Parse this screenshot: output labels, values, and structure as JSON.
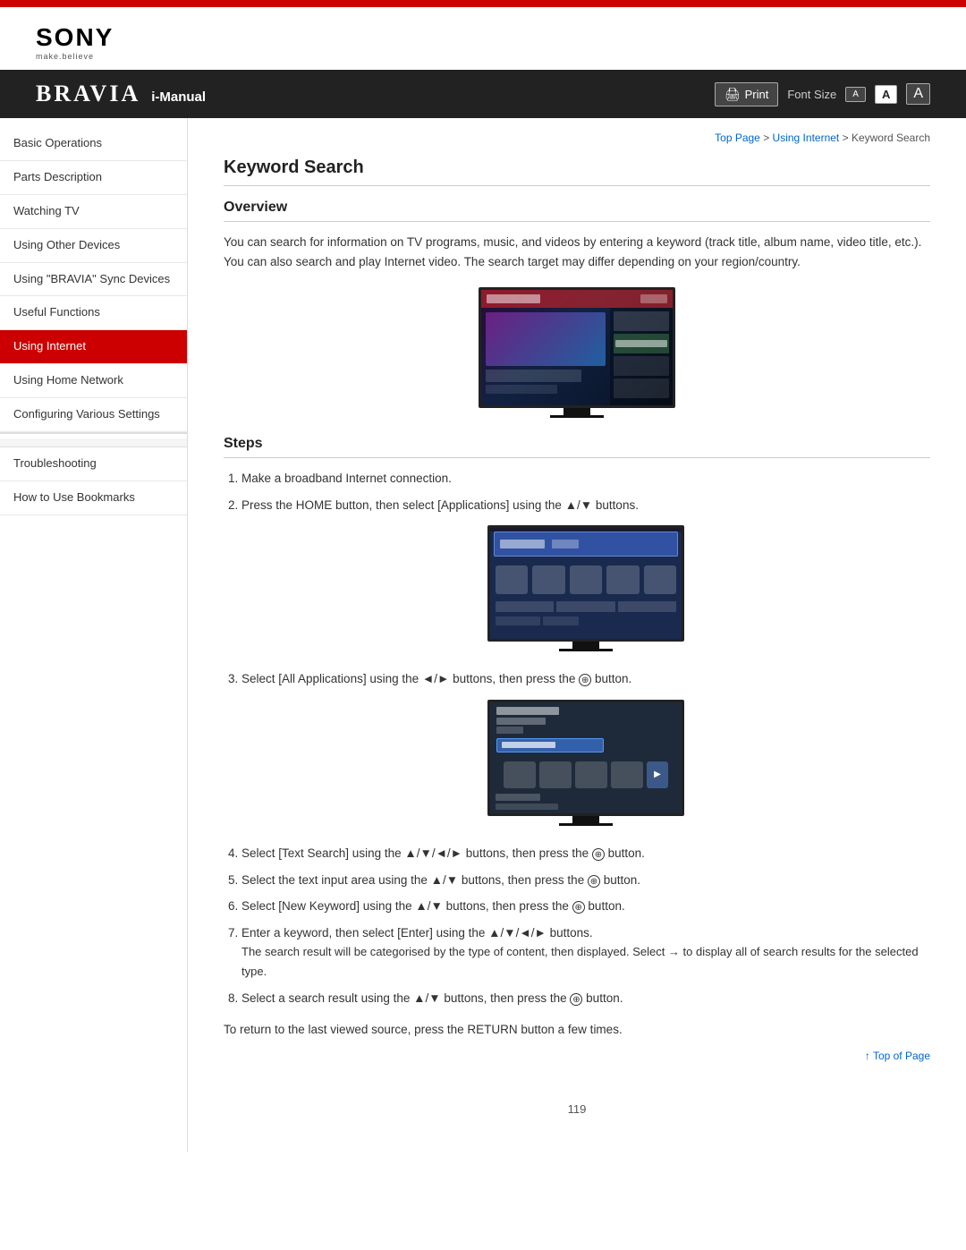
{
  "header": {
    "top_bar_color": "#cc0000",
    "logo": "SONY",
    "tagline": "make.believe",
    "bravia": "BRAVIA",
    "imanual": "i-Manual",
    "print_label": "Print",
    "font_size_label": "Font Size",
    "font_sizes": [
      "A",
      "A",
      "A"
    ]
  },
  "breadcrumb": {
    "top_page": "Top Page",
    "using_internet": "Using Internet",
    "current": "Keyword Search",
    "separator": ">"
  },
  "sidebar": {
    "items": [
      {
        "id": "basic-operations",
        "label": "Basic Operations",
        "active": false
      },
      {
        "id": "parts-description",
        "label": "Parts Description",
        "active": false
      },
      {
        "id": "watching-tv",
        "label": "Watching TV",
        "active": false
      },
      {
        "id": "using-other-devices",
        "label": "Using Other Devices",
        "active": false
      },
      {
        "id": "using-bravia-sync",
        "label": "Using \"BRAVIA\" Sync Devices",
        "active": false
      },
      {
        "id": "useful-functions",
        "label": "Useful Functions",
        "active": false
      },
      {
        "id": "using-internet",
        "label": "Using Internet",
        "active": true
      },
      {
        "id": "using-home-network",
        "label": "Using Home Network",
        "active": false
      },
      {
        "id": "configuring-various-settings",
        "label": "Configuring Various Settings",
        "active": false
      }
    ],
    "bottom_items": [
      {
        "id": "troubleshooting",
        "label": "Troubleshooting"
      },
      {
        "id": "how-to-use-bookmarks",
        "label": "How to Use Bookmarks"
      }
    ]
  },
  "content": {
    "page_title": "Keyword Search",
    "overview": {
      "title": "Overview",
      "text": "You can search for information on TV programs, music, and videos by entering a keyword (track title, album name, video title, etc.). You can also search and play Internet video. The search target may differ depending on your region/country."
    },
    "steps": {
      "title": "Steps",
      "items": [
        {
          "num": 1,
          "text": "Make a broadband Internet connection.",
          "has_image": false
        },
        {
          "num": 2,
          "text": "Press the HOME button, then select [Applications] using the ▲/▼ buttons.",
          "has_image": true
        },
        {
          "num": 3,
          "text": "Select [All Applications] using the ◄/► buttons, then press the ⊕ button.",
          "has_image": true
        },
        {
          "num": 4,
          "text": "Select [Text Search] using the ▲/▼/◄/► buttons, then press the ⊕ button.",
          "has_image": false
        },
        {
          "num": 5,
          "text": "Select the text input area using the ▲/▼ buttons, then press the ⊕ button.",
          "has_image": false
        },
        {
          "num": 6,
          "text": "Select [New Keyword] using the ▲/▼ buttons, then press the ⊕ button.",
          "has_image": false
        },
        {
          "num": 7,
          "text": "Enter a keyword, then select [Enter] using the ▲/▼/◄/► buttons.",
          "has_image": false,
          "note": "The search result will be categorised by the type of content, then displayed. Select → to display all of search results for the selected type."
        },
        {
          "num": 8,
          "text": "Select a search result using the ▲/▼ buttons, then press the ⊕ button.",
          "has_image": false
        }
      ],
      "footer_note": "To return to the last viewed source, press the RETURN button a few times."
    },
    "page_number": "119",
    "top_of_page": "Top of Page"
  }
}
